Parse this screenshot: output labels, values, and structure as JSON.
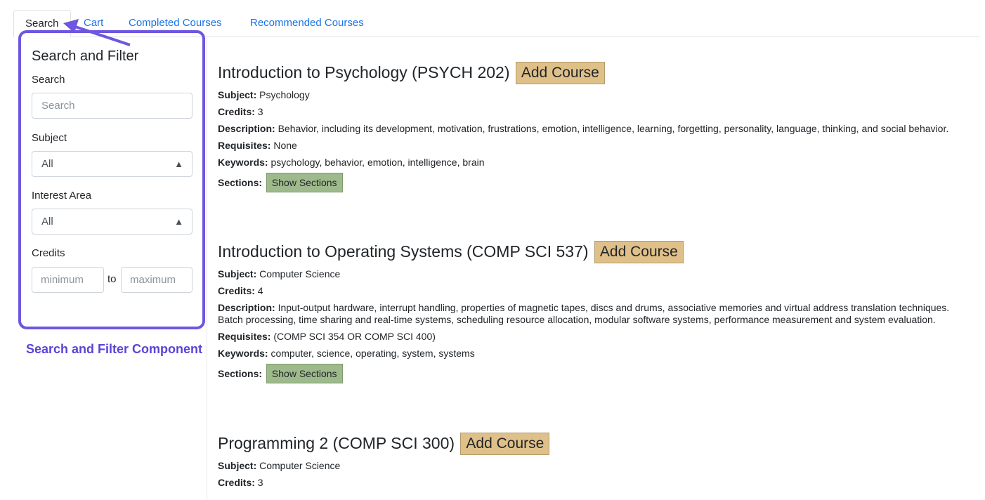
{
  "tabs": [
    {
      "label": "Search"
    },
    {
      "label": "Cart"
    },
    {
      "label": "Completed Courses"
    },
    {
      "label": "Recommended Courses"
    }
  ],
  "filter": {
    "title": "Search and Filter",
    "search_label": "Search",
    "search_placeholder": "Search",
    "subject_label": "Subject",
    "subject_value": "All",
    "interest_label": "Interest Area",
    "interest_value": "All",
    "credits_label": "Credits",
    "min_placeholder": "minimum",
    "to_text": "to",
    "max_placeholder": "maximum"
  },
  "annotation": "Search and Filter Component",
  "labels": {
    "subject": "Subject:",
    "credits": "Credits:",
    "description": "Description:",
    "requisites": "Requisites:",
    "keywords": "Keywords:",
    "sections": "Sections:",
    "add_course": "Add Course",
    "show_sections": "Show Sections"
  },
  "courses": [
    {
      "title": "Introduction to Psychology (PSYCH 202)",
      "subject": "Psychology",
      "credits": "3",
      "description": "Behavior, including its development, motivation, frustrations, emotion, intelligence, learning, forgetting, personality, language, thinking, and social behavior.",
      "requisites": "None",
      "keywords": "psychology, behavior, emotion, intelligence, brain"
    },
    {
      "title": "Introduction to Operating Systems (COMP SCI 537)",
      "subject": "Computer Science",
      "credits": "4",
      "description": "Input-output hardware, interrupt handling, properties of magnetic tapes, discs and drums, associative memories and virtual address translation techniques. Batch processing, time sharing and real-time systems, scheduling resource allocation, modular software systems, performance measurement and system evaluation.",
      "requisites": "(COMP SCI 354 OR COMP SCI 400)",
      "keywords": "computer, science, operating, system, systems"
    },
    {
      "title": "Programming 2 (COMP SCI 300)",
      "subject": "Computer Science",
      "credits": "3"
    }
  ],
  "colors": {
    "accent_purple": "#6e56e0",
    "add_button": "#e0c089",
    "show_button": "#9eba8c",
    "link_blue": "#1a73e8"
  }
}
